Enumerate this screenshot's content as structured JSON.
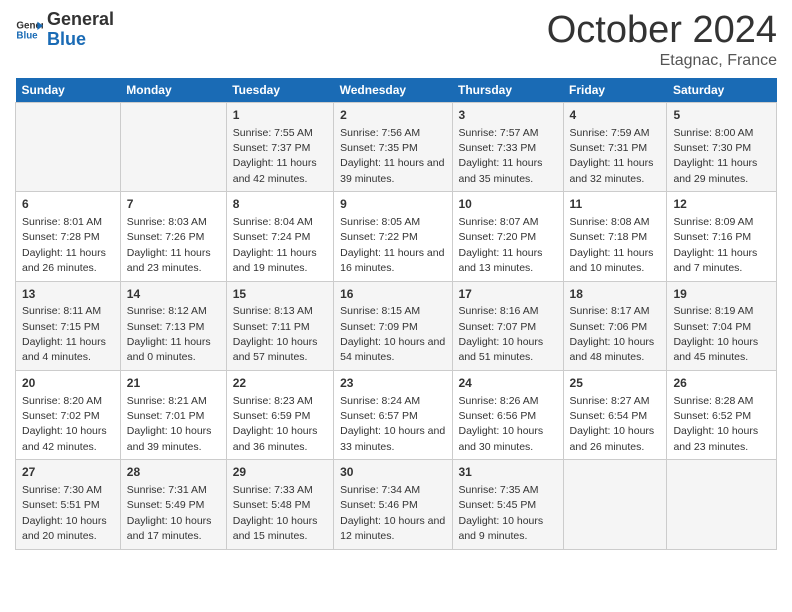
{
  "header": {
    "logo_text_general": "General",
    "logo_text_blue": "Blue",
    "month": "October 2024",
    "location": "Etagnac, France"
  },
  "days_of_week": [
    "Sunday",
    "Monday",
    "Tuesday",
    "Wednesday",
    "Thursday",
    "Friday",
    "Saturday"
  ],
  "weeks": [
    [
      {
        "day": "",
        "info": ""
      },
      {
        "day": "",
        "info": ""
      },
      {
        "day": "1",
        "info": "Sunrise: 7:55 AM\nSunset: 7:37 PM\nDaylight: 11 hours and 42 minutes."
      },
      {
        "day": "2",
        "info": "Sunrise: 7:56 AM\nSunset: 7:35 PM\nDaylight: 11 hours and 39 minutes."
      },
      {
        "day": "3",
        "info": "Sunrise: 7:57 AM\nSunset: 7:33 PM\nDaylight: 11 hours and 35 minutes."
      },
      {
        "day": "4",
        "info": "Sunrise: 7:59 AM\nSunset: 7:31 PM\nDaylight: 11 hours and 32 minutes."
      },
      {
        "day": "5",
        "info": "Sunrise: 8:00 AM\nSunset: 7:30 PM\nDaylight: 11 hours and 29 minutes."
      }
    ],
    [
      {
        "day": "6",
        "info": "Sunrise: 8:01 AM\nSunset: 7:28 PM\nDaylight: 11 hours and 26 minutes."
      },
      {
        "day": "7",
        "info": "Sunrise: 8:03 AM\nSunset: 7:26 PM\nDaylight: 11 hours and 23 minutes."
      },
      {
        "day": "8",
        "info": "Sunrise: 8:04 AM\nSunset: 7:24 PM\nDaylight: 11 hours and 19 minutes."
      },
      {
        "day": "9",
        "info": "Sunrise: 8:05 AM\nSunset: 7:22 PM\nDaylight: 11 hours and 16 minutes."
      },
      {
        "day": "10",
        "info": "Sunrise: 8:07 AM\nSunset: 7:20 PM\nDaylight: 11 hours and 13 minutes."
      },
      {
        "day": "11",
        "info": "Sunrise: 8:08 AM\nSunset: 7:18 PM\nDaylight: 11 hours and 10 minutes."
      },
      {
        "day": "12",
        "info": "Sunrise: 8:09 AM\nSunset: 7:16 PM\nDaylight: 11 hours and 7 minutes."
      }
    ],
    [
      {
        "day": "13",
        "info": "Sunrise: 8:11 AM\nSunset: 7:15 PM\nDaylight: 11 hours and 4 minutes."
      },
      {
        "day": "14",
        "info": "Sunrise: 8:12 AM\nSunset: 7:13 PM\nDaylight: 11 hours and 0 minutes."
      },
      {
        "day": "15",
        "info": "Sunrise: 8:13 AM\nSunset: 7:11 PM\nDaylight: 10 hours and 57 minutes."
      },
      {
        "day": "16",
        "info": "Sunrise: 8:15 AM\nSunset: 7:09 PM\nDaylight: 10 hours and 54 minutes."
      },
      {
        "day": "17",
        "info": "Sunrise: 8:16 AM\nSunset: 7:07 PM\nDaylight: 10 hours and 51 minutes."
      },
      {
        "day": "18",
        "info": "Sunrise: 8:17 AM\nSunset: 7:06 PM\nDaylight: 10 hours and 48 minutes."
      },
      {
        "day": "19",
        "info": "Sunrise: 8:19 AM\nSunset: 7:04 PM\nDaylight: 10 hours and 45 minutes."
      }
    ],
    [
      {
        "day": "20",
        "info": "Sunrise: 8:20 AM\nSunset: 7:02 PM\nDaylight: 10 hours and 42 minutes."
      },
      {
        "day": "21",
        "info": "Sunrise: 8:21 AM\nSunset: 7:01 PM\nDaylight: 10 hours and 39 minutes."
      },
      {
        "day": "22",
        "info": "Sunrise: 8:23 AM\nSunset: 6:59 PM\nDaylight: 10 hours and 36 minutes."
      },
      {
        "day": "23",
        "info": "Sunrise: 8:24 AM\nSunset: 6:57 PM\nDaylight: 10 hours and 33 minutes."
      },
      {
        "day": "24",
        "info": "Sunrise: 8:26 AM\nSunset: 6:56 PM\nDaylight: 10 hours and 30 minutes."
      },
      {
        "day": "25",
        "info": "Sunrise: 8:27 AM\nSunset: 6:54 PM\nDaylight: 10 hours and 26 minutes."
      },
      {
        "day": "26",
        "info": "Sunrise: 8:28 AM\nSunset: 6:52 PM\nDaylight: 10 hours and 23 minutes."
      }
    ],
    [
      {
        "day": "27",
        "info": "Sunrise: 7:30 AM\nSunset: 5:51 PM\nDaylight: 10 hours and 20 minutes."
      },
      {
        "day": "28",
        "info": "Sunrise: 7:31 AM\nSunset: 5:49 PM\nDaylight: 10 hours and 17 minutes."
      },
      {
        "day": "29",
        "info": "Sunrise: 7:33 AM\nSunset: 5:48 PM\nDaylight: 10 hours and 15 minutes."
      },
      {
        "day": "30",
        "info": "Sunrise: 7:34 AM\nSunset: 5:46 PM\nDaylight: 10 hours and 12 minutes."
      },
      {
        "day": "31",
        "info": "Sunrise: 7:35 AM\nSunset: 5:45 PM\nDaylight: 10 hours and 9 minutes."
      },
      {
        "day": "",
        "info": ""
      },
      {
        "day": "",
        "info": ""
      }
    ]
  ]
}
